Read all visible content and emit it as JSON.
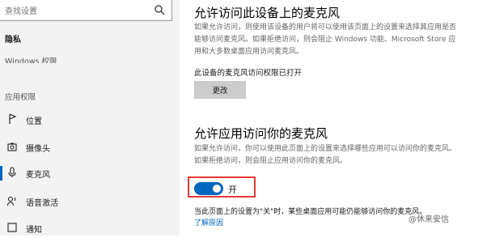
{
  "sidebar": {
    "search_placeholder": "查找设置",
    "section_title": "隐私",
    "windows_permissions": "Windows 权限",
    "app_permissions_header": "应用权限",
    "items": [
      {
        "label": "位置",
        "icon": "location-icon"
      },
      {
        "label": "摄像头",
        "icon": "camera-icon"
      },
      {
        "label": "麦克风",
        "icon": "microphone-icon",
        "active": true
      },
      {
        "label": "语音激活",
        "icon": "voice-activation-icon"
      },
      {
        "label": "通知",
        "icon": "notification-icon"
      }
    ]
  },
  "main": {
    "device_section": {
      "title": "允许访问此设备上的麦克风",
      "description": "如果允许访问，则使用该设备的用户将可以使用该页面上的设置来选择其应用是否能够访问麦克风。如果拒绝访问，则会阻止 Windows 功能、Microsoft Store 应用和大多数桌面应用访问麦克风。",
      "status": "此设备的麦克风访问权限已打开",
      "change_button": "更改"
    },
    "app_section": {
      "title": "允许应用访问你的麦克风",
      "description": "如果允许访问，你可以使用此页面上的设置来选择哪些应用可以访问你的麦克风。如果拒绝访问，则会阻止应用访问你的麦克风。",
      "toggle_state_label": "开",
      "toggle_on": true,
      "note": "当此页面上的设置为\"关\"时，某些桌面应用可能仍能够访问你的麦克风。",
      "learn_more": "了解原因"
    }
  },
  "watermark": "@休来安信",
  "colors": {
    "accent": "#0067c0",
    "highlight_border": "#e53935"
  }
}
